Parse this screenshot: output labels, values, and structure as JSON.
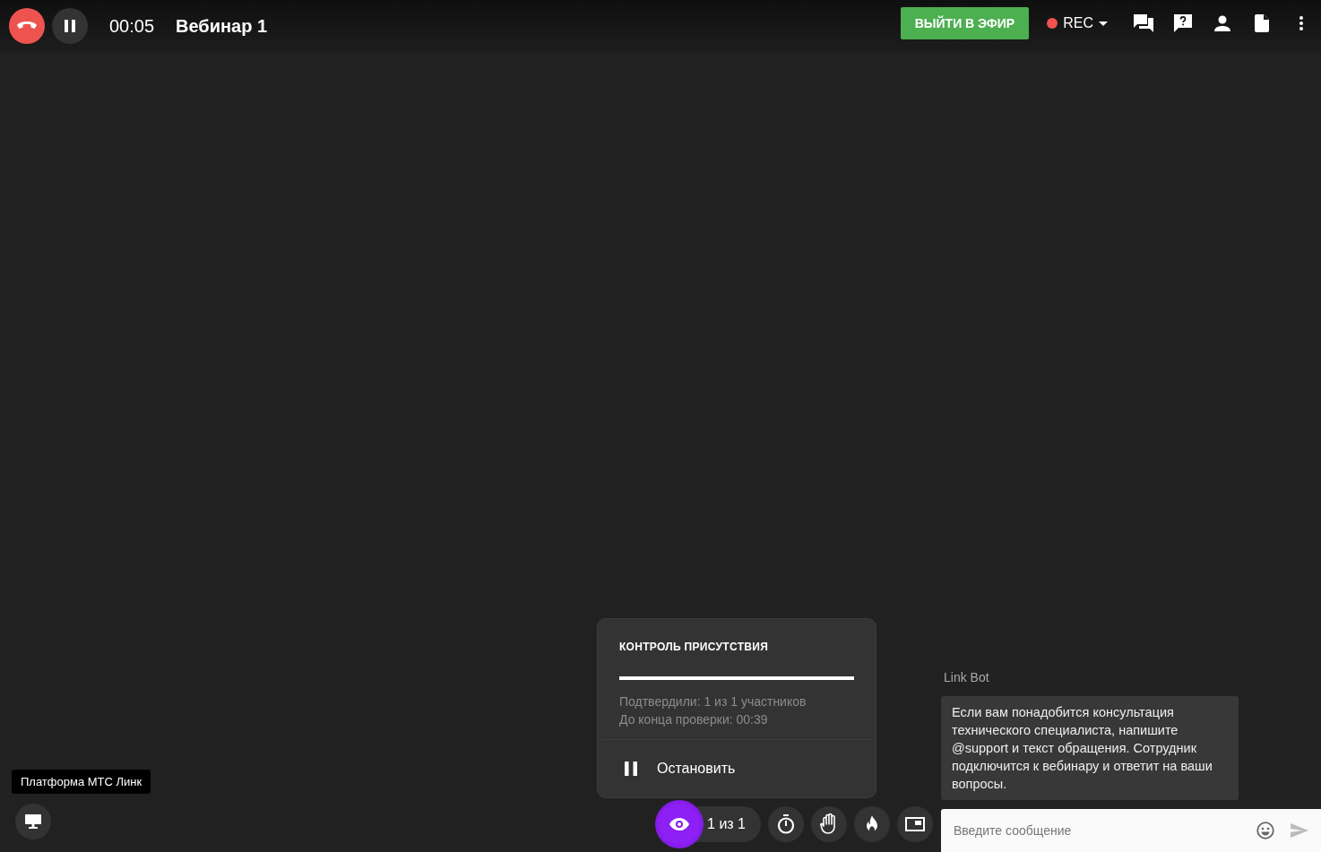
{
  "top_bar": {
    "timer": "00:05",
    "title": "Вебинар 1",
    "go_live_button": "ВЫЙТИ В ЭФИР",
    "record": {
      "label": "REC",
      "recording": true
    }
  },
  "presence_popup": {
    "title": "КОНТРОЛЬ ПРИСУТСТВИЯ",
    "level": 1,
    "confirmed": "Подтвердили: 1 из 1 участников",
    "remaining": "До конца проверки: 00:39",
    "stop_button": "Остановить"
  },
  "toolbar": {
    "presence": {
      "count": "1 из 1",
      "active": true
    }
  },
  "tooltip": "Платформа МТС Линк",
  "chat": {
    "sender": "Link Bot",
    "message": "Если вам понадобится консультация технического специалиста, напишите @support и текст обращения. Сотрудник подключится к вебинару и ответит на ваши вопросы.",
    "input": {
      "placeholder": "Введите сообщение"
    }
  }
}
